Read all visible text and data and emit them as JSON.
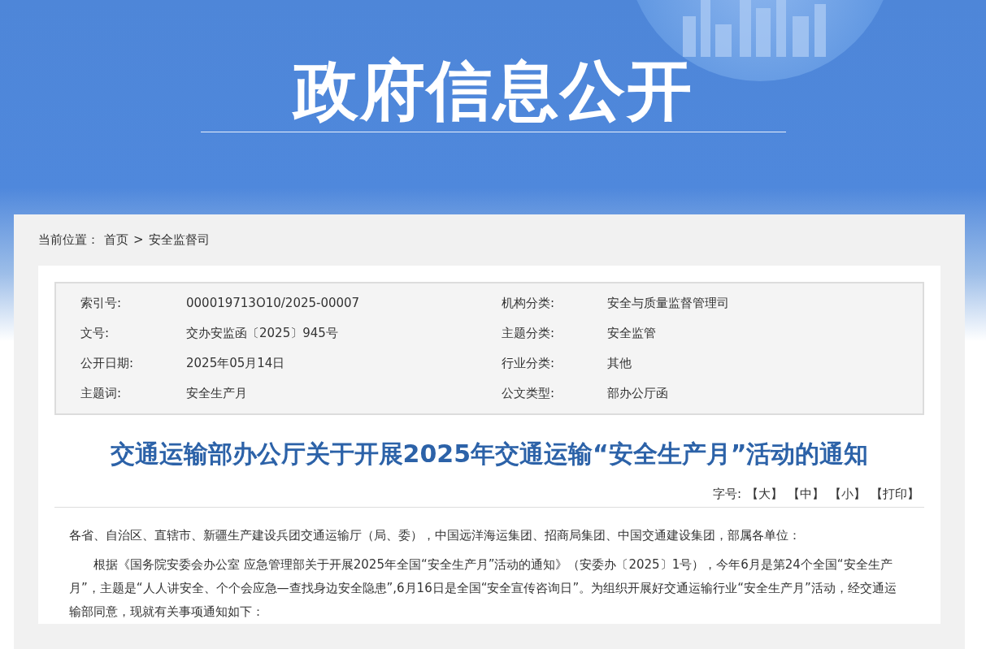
{
  "banner": {
    "title": "政府信息公开"
  },
  "breadcrumb": {
    "label": "当前位置：",
    "items": [
      {
        "text": "首页"
      },
      {
        "text": "安全监督司"
      }
    ],
    "separator": ">"
  },
  "metadata": [
    {
      "label": "索引号:",
      "value": "000019713O10/2025-00007"
    },
    {
      "label": "机构分类:",
      "value": "安全与质量监督管理司"
    },
    {
      "label": "文号:",
      "value": "交办安监函〔2025〕945号"
    },
    {
      "label": "主题分类:",
      "value": "安全监管"
    },
    {
      "label": "公开日期:",
      "value": "2025年05月14日"
    },
    {
      "label": "行业分类:",
      "value": "其他"
    },
    {
      "label": "主题词:",
      "value": "安全生产月"
    },
    {
      "label": "公文类型:",
      "value": "部办公厅函"
    }
  ],
  "article": {
    "title": "交通运输部办公厅关于开展2025年交通运输“安全生产月”活动的通知",
    "font_size_label": "字号:",
    "tools": [
      "【大】",
      "【中】",
      "【小】",
      "【打印】"
    ],
    "paragraphs": [
      {
        "kind": "salutation",
        "text": "各省、自治区、直辖市、新疆生产建设兵团交通运输厅（局、委），中国远洋海运集团、招商局集团、中国交通建设集团，部属各单位："
      },
      {
        "kind": "body",
        "text": "根据《国务院安委会办公室 应急管理部关于开展2025年全国“安全生产月”活动的通知》（安委办〔2025〕1号），今年6月是第24个全国“安全生产月”，主题是“人人讲安全、个个会应急—查找身边安全隐患”,6月16日是全国“安全宣传咨询日”。为组织开展好交通运输行业“安全生产月”活动，经交通运输部同意，现就有关事项通知如下："
      }
    ]
  }
}
